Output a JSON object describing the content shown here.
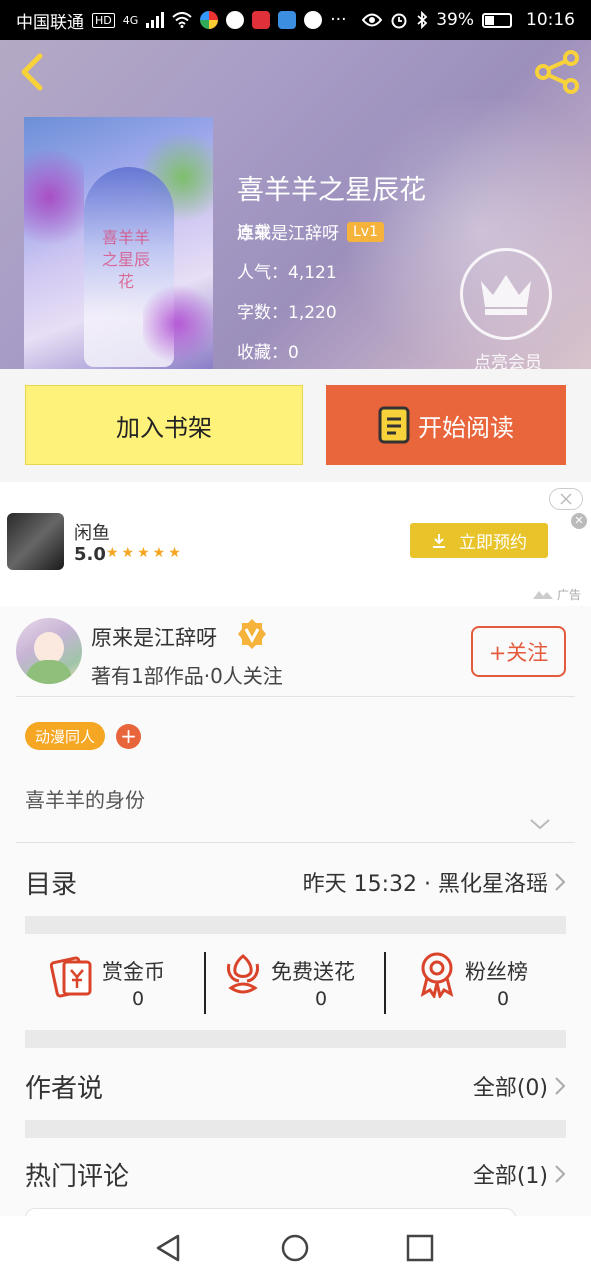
{
  "status_bar": {
    "carrier": "中国联通",
    "hd": "HD",
    "network": "4G",
    "more": "···",
    "battery": "39%",
    "time": "10:16",
    "battery_level": 0.39
  },
  "book": {
    "title": "喜羊羊之星辰花",
    "author": "原来是江辞呀",
    "level": "Lv1",
    "status": "连载",
    "popularity_label": "人气：",
    "popularity": "4,121",
    "word_count_label": "字数：",
    "word_count": "1,220",
    "favorites_label": "收藏：",
    "favorites": "0",
    "vip_label": "点亮会员",
    "cover_text": "喜羊羊之星辰花"
  },
  "actions": {
    "add_to_shelf": "加入书架",
    "start_reading": "开始阅读"
  },
  "ad": {
    "app_name": "闲鱼",
    "rating": "5.0",
    "stars": "★★★★★",
    "cta": "立即预约",
    "label": "广告"
  },
  "author_card": {
    "name": "原来是江辞呀",
    "stats": "著有1部作品·0人关注",
    "follow": "+关注",
    "tag": "动漫同人",
    "tag_add": "+",
    "synopsis": "喜羊羊的身份"
  },
  "catalog": {
    "label": "目录",
    "latest": "昨天 15:32 · 黑化星洛瑶"
  },
  "stats": [
    {
      "label": "赏金币",
      "value": "0"
    },
    {
      "label": "免费送花",
      "value": "0"
    },
    {
      "label": "粉丝榜",
      "value": "0"
    }
  ],
  "author_says": {
    "label": "作者说",
    "value": "全部(0)"
  },
  "hot_comments": {
    "label": "热门评论",
    "value": "全部(1)"
  },
  "colors": {
    "accent_orange": "#e9653b",
    "shelf_yellow": "#fff27a",
    "badge_gold": "#f5b33b",
    "icon_red": "#d9442b"
  }
}
